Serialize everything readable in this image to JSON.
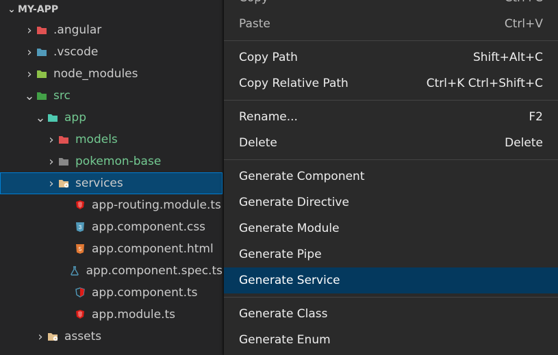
{
  "explorer": {
    "title": "MY-APP",
    "items": [
      {
        "chev": "›",
        "icon": "folder-red",
        "label": ".angular",
        "green": false,
        "indent": 34,
        "sel": false
      },
      {
        "chev": "›",
        "icon": "folder-blue",
        "label": ".vscode",
        "green": false,
        "indent": 34,
        "sel": false
      },
      {
        "chev": "›",
        "icon": "folder-lime",
        "label": "node_modules",
        "green": false,
        "indent": 34,
        "sel": false
      },
      {
        "chev": "⌄",
        "icon": "folder-emerald",
        "label": "src",
        "green": true,
        "indent": 34,
        "sel": false
      },
      {
        "chev": "⌄",
        "icon": "folder-teal",
        "label": "app",
        "green": true,
        "indent": 50,
        "sel": false
      },
      {
        "chev": "›",
        "icon": "folder-red",
        "label": "models",
        "green": true,
        "indent": 66,
        "sel": false
      },
      {
        "chev": "›",
        "icon": "folder-gray",
        "label": "pokemon-base",
        "green": true,
        "indent": 66,
        "sel": false
      },
      {
        "chev": "›",
        "icon": "folder-yellow",
        "label": "services",
        "green": false,
        "indent": 66,
        "sel": true
      },
      {
        "chev": "",
        "icon": "file-ang",
        "label": "app-routing.module.ts",
        "green": false,
        "indent": 90,
        "sel": false
      },
      {
        "chev": "",
        "icon": "file-css",
        "label": "app.component.css",
        "green": false,
        "indent": 90,
        "sel": false
      },
      {
        "chev": "",
        "icon": "file-html",
        "label": "app.component.html",
        "green": false,
        "indent": 90,
        "sel": false
      },
      {
        "chev": "",
        "icon": "file-spec",
        "label": "app.component.spec.ts",
        "green": false,
        "indent": 90,
        "sel": false
      },
      {
        "chev": "",
        "icon": "file-ang2",
        "label": "app.component.ts",
        "green": false,
        "indent": 90,
        "sel": false
      },
      {
        "chev": "",
        "icon": "file-ang",
        "label": "app.module.ts",
        "green": false,
        "indent": 90,
        "sel": false
      },
      {
        "chev": "›",
        "icon": "folder-yellow",
        "label": "assets",
        "green": false,
        "indent": 50,
        "sel": false
      }
    ]
  },
  "context_menu": {
    "groups": [
      [
        {
          "label": "Copy",
          "kb": "Ctrl+C",
          "enabled": false,
          "hi": false
        },
        {
          "label": "Paste",
          "kb": "Ctrl+V",
          "enabled": false,
          "hi": false
        }
      ],
      [
        {
          "label": "Copy Path",
          "kb": "Shift+Alt+C",
          "enabled": true,
          "hi": false
        },
        {
          "label": "Copy Relative Path",
          "kb": "Ctrl+K Ctrl+Shift+C",
          "enabled": true,
          "hi": false
        }
      ],
      [
        {
          "label": "Rename...",
          "kb": "F2",
          "enabled": true,
          "hi": false
        },
        {
          "label": "Delete",
          "kb": "Delete",
          "enabled": true,
          "hi": false
        }
      ],
      [
        {
          "label": "Generate Component",
          "kb": "",
          "enabled": true,
          "hi": false
        },
        {
          "label": "Generate Directive",
          "kb": "",
          "enabled": true,
          "hi": false
        },
        {
          "label": "Generate Module",
          "kb": "",
          "enabled": true,
          "hi": false
        },
        {
          "label": "Generate Pipe",
          "kb": "",
          "enabled": true,
          "hi": false
        },
        {
          "label": "Generate Service",
          "kb": "",
          "enabled": true,
          "hi": true
        }
      ],
      [
        {
          "label": "Generate Class",
          "kb": "",
          "enabled": true,
          "hi": false
        },
        {
          "label": "Generate Enum",
          "kb": "",
          "enabled": true,
          "hi": false
        }
      ]
    ]
  }
}
